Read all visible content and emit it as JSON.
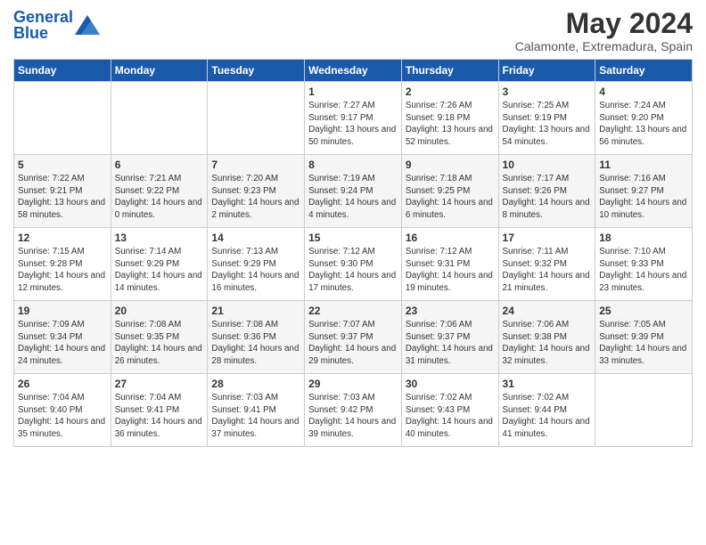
{
  "header": {
    "logo_general": "General",
    "logo_blue": "Blue",
    "month_title": "May 2024",
    "subtitle": "Calamonte, Extremadura, Spain"
  },
  "weekdays": [
    "Sunday",
    "Monday",
    "Tuesday",
    "Wednesday",
    "Thursday",
    "Friday",
    "Saturday"
  ],
  "weeks": [
    [
      {
        "day": "",
        "sunrise": "",
        "sunset": "",
        "daylight": ""
      },
      {
        "day": "",
        "sunrise": "",
        "sunset": "",
        "daylight": ""
      },
      {
        "day": "",
        "sunrise": "",
        "sunset": "",
        "daylight": ""
      },
      {
        "day": "1",
        "sunrise": "Sunrise: 7:27 AM",
        "sunset": "Sunset: 9:17 PM",
        "daylight": "Daylight: 13 hours and 50 minutes."
      },
      {
        "day": "2",
        "sunrise": "Sunrise: 7:26 AM",
        "sunset": "Sunset: 9:18 PM",
        "daylight": "Daylight: 13 hours and 52 minutes."
      },
      {
        "day": "3",
        "sunrise": "Sunrise: 7:25 AM",
        "sunset": "Sunset: 9:19 PM",
        "daylight": "Daylight: 13 hours and 54 minutes."
      },
      {
        "day": "4",
        "sunrise": "Sunrise: 7:24 AM",
        "sunset": "Sunset: 9:20 PM",
        "daylight": "Daylight: 13 hours and 56 minutes."
      }
    ],
    [
      {
        "day": "5",
        "sunrise": "Sunrise: 7:22 AM",
        "sunset": "Sunset: 9:21 PM",
        "daylight": "Daylight: 13 hours and 58 minutes."
      },
      {
        "day": "6",
        "sunrise": "Sunrise: 7:21 AM",
        "sunset": "Sunset: 9:22 PM",
        "daylight": "Daylight: 14 hours and 0 minutes."
      },
      {
        "day": "7",
        "sunrise": "Sunrise: 7:20 AM",
        "sunset": "Sunset: 9:23 PM",
        "daylight": "Daylight: 14 hours and 2 minutes."
      },
      {
        "day": "8",
        "sunrise": "Sunrise: 7:19 AM",
        "sunset": "Sunset: 9:24 PM",
        "daylight": "Daylight: 14 hours and 4 minutes."
      },
      {
        "day": "9",
        "sunrise": "Sunrise: 7:18 AM",
        "sunset": "Sunset: 9:25 PM",
        "daylight": "Daylight: 14 hours and 6 minutes."
      },
      {
        "day": "10",
        "sunrise": "Sunrise: 7:17 AM",
        "sunset": "Sunset: 9:26 PM",
        "daylight": "Daylight: 14 hours and 8 minutes."
      },
      {
        "day": "11",
        "sunrise": "Sunrise: 7:16 AM",
        "sunset": "Sunset: 9:27 PM",
        "daylight": "Daylight: 14 hours and 10 minutes."
      }
    ],
    [
      {
        "day": "12",
        "sunrise": "Sunrise: 7:15 AM",
        "sunset": "Sunset: 9:28 PM",
        "daylight": "Daylight: 14 hours and 12 minutes."
      },
      {
        "day": "13",
        "sunrise": "Sunrise: 7:14 AM",
        "sunset": "Sunset: 9:29 PM",
        "daylight": "Daylight: 14 hours and 14 minutes."
      },
      {
        "day": "14",
        "sunrise": "Sunrise: 7:13 AM",
        "sunset": "Sunset: 9:29 PM",
        "daylight": "Daylight: 14 hours and 16 minutes."
      },
      {
        "day": "15",
        "sunrise": "Sunrise: 7:12 AM",
        "sunset": "Sunset: 9:30 PM",
        "daylight": "Daylight: 14 hours and 17 minutes."
      },
      {
        "day": "16",
        "sunrise": "Sunrise: 7:12 AM",
        "sunset": "Sunset: 9:31 PM",
        "daylight": "Daylight: 14 hours and 19 minutes."
      },
      {
        "day": "17",
        "sunrise": "Sunrise: 7:11 AM",
        "sunset": "Sunset: 9:32 PM",
        "daylight": "Daylight: 14 hours and 21 minutes."
      },
      {
        "day": "18",
        "sunrise": "Sunrise: 7:10 AM",
        "sunset": "Sunset: 9:33 PM",
        "daylight": "Daylight: 14 hours and 23 minutes."
      }
    ],
    [
      {
        "day": "19",
        "sunrise": "Sunrise: 7:09 AM",
        "sunset": "Sunset: 9:34 PM",
        "daylight": "Daylight: 14 hours and 24 minutes."
      },
      {
        "day": "20",
        "sunrise": "Sunrise: 7:08 AM",
        "sunset": "Sunset: 9:35 PM",
        "daylight": "Daylight: 14 hours and 26 minutes."
      },
      {
        "day": "21",
        "sunrise": "Sunrise: 7:08 AM",
        "sunset": "Sunset: 9:36 PM",
        "daylight": "Daylight: 14 hours and 28 minutes."
      },
      {
        "day": "22",
        "sunrise": "Sunrise: 7:07 AM",
        "sunset": "Sunset: 9:37 PM",
        "daylight": "Daylight: 14 hours and 29 minutes."
      },
      {
        "day": "23",
        "sunrise": "Sunrise: 7:06 AM",
        "sunset": "Sunset: 9:37 PM",
        "daylight": "Daylight: 14 hours and 31 minutes."
      },
      {
        "day": "24",
        "sunrise": "Sunrise: 7:06 AM",
        "sunset": "Sunset: 9:38 PM",
        "daylight": "Daylight: 14 hours and 32 minutes."
      },
      {
        "day": "25",
        "sunrise": "Sunrise: 7:05 AM",
        "sunset": "Sunset: 9:39 PM",
        "daylight": "Daylight: 14 hours and 33 minutes."
      }
    ],
    [
      {
        "day": "26",
        "sunrise": "Sunrise: 7:04 AM",
        "sunset": "Sunset: 9:40 PM",
        "daylight": "Daylight: 14 hours and 35 minutes."
      },
      {
        "day": "27",
        "sunrise": "Sunrise: 7:04 AM",
        "sunset": "Sunset: 9:41 PM",
        "daylight": "Daylight: 14 hours and 36 minutes."
      },
      {
        "day": "28",
        "sunrise": "Sunrise: 7:03 AM",
        "sunset": "Sunset: 9:41 PM",
        "daylight": "Daylight: 14 hours and 37 minutes."
      },
      {
        "day": "29",
        "sunrise": "Sunrise: 7:03 AM",
        "sunset": "Sunset: 9:42 PM",
        "daylight": "Daylight: 14 hours and 39 minutes."
      },
      {
        "day": "30",
        "sunrise": "Sunrise: 7:02 AM",
        "sunset": "Sunset: 9:43 PM",
        "daylight": "Daylight: 14 hours and 40 minutes."
      },
      {
        "day": "31",
        "sunrise": "Sunrise: 7:02 AM",
        "sunset": "Sunset: 9:44 PM",
        "daylight": "Daylight: 14 hours and 41 minutes."
      },
      {
        "day": "",
        "sunrise": "",
        "sunset": "",
        "daylight": ""
      }
    ]
  ]
}
